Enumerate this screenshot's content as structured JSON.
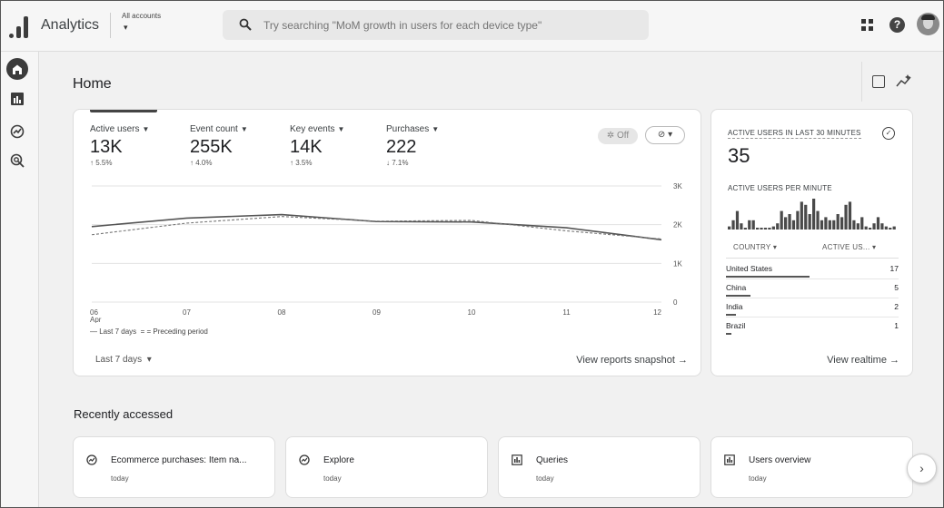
{
  "app": {
    "name": "Analytics",
    "account_label": "All accounts",
    "account_caret": "▾"
  },
  "search": {
    "placeholder": "Try searching \"MoM growth in users for each device type\""
  },
  "page": {
    "title": "Home"
  },
  "metrics": [
    {
      "label": "Active users",
      "value": "13K",
      "change": "↑ 5.5%"
    },
    {
      "label": "Event count",
      "value": "255K",
      "change": "↑ 4.0%"
    },
    {
      "label": "Key events",
      "value": "14K",
      "change": "↑ 3.5%"
    },
    {
      "label": "Purchases",
      "value": "222",
      "change": "↓ 7.1%"
    }
  ],
  "toggles": {
    "off_label": "Off",
    "compare_label": "⊘ ▾"
  },
  "chart_data": {
    "type": "line",
    "x": [
      "06",
      "07",
      "08",
      "09",
      "10",
      "11",
      "12"
    ],
    "x_sublabel": "Apr",
    "y_ticks": [
      "3K",
      "2K",
      "1K",
      "0"
    ],
    "ylim": [
      0,
      3000
    ],
    "grid": true,
    "series": [
      {
        "name": "Last 7 days",
        "values": [
          1950,
          2170,
          2260,
          2080,
          2070,
          1920,
          1610
        ]
      },
      {
        "name": "Preceding period",
        "values": [
          1740,
          2040,
          2210,
          2090,
          2110,
          1840,
          1630
        ]
      }
    ]
  },
  "legend": {
    "current": "— Last 7 days",
    "previous": "= = Preceding period"
  },
  "period": {
    "label": "Last 7 days",
    "caret": "▾"
  },
  "links": {
    "snapshot": "View reports snapshot →",
    "realtime": "View realtime →"
  },
  "realtime": {
    "title": "ACTIVE USERS IN LAST 30 MINUTES",
    "value": "35",
    "per_minute_label": "ACTIVE USERS PER MINUTE",
    "per_minute": [
      1,
      3,
      6,
      2,
      0,
      3,
      3,
      0,
      0,
      0,
      0,
      1,
      2,
      6,
      4,
      5,
      3,
      6,
      9,
      8,
      5,
      10,
      6,
      3,
      4,
      3,
      3,
      5,
      4,
      8,
      9,
      3,
      2,
      4,
      1,
      0,
      2,
      4,
      2,
      1,
      0,
      1
    ],
    "col_country": "COUNTRY ▾",
    "col_users": "ACTIVE US... ▾",
    "rows": [
      {
        "name": "United States",
        "value": "17",
        "share": 1.0
      },
      {
        "name": "China",
        "value": "5",
        "share": 0.29
      },
      {
        "name": "India",
        "value": "2",
        "share": 0.12
      },
      {
        "name": "Brazil",
        "value": "1",
        "share": 0.06
      }
    ]
  },
  "recent": {
    "title": "Recently accessed",
    "items": [
      {
        "name": "Ecommerce purchases: Item na...",
        "time": "today",
        "icon": "explore-icon"
      },
      {
        "name": "Explore",
        "time": "today",
        "icon": "explore-icon"
      },
      {
        "name": "Queries",
        "time": "today",
        "icon": "report-icon"
      },
      {
        "name": "Users overview",
        "time": "today",
        "icon": "report-icon"
      }
    ],
    "next": "›"
  }
}
